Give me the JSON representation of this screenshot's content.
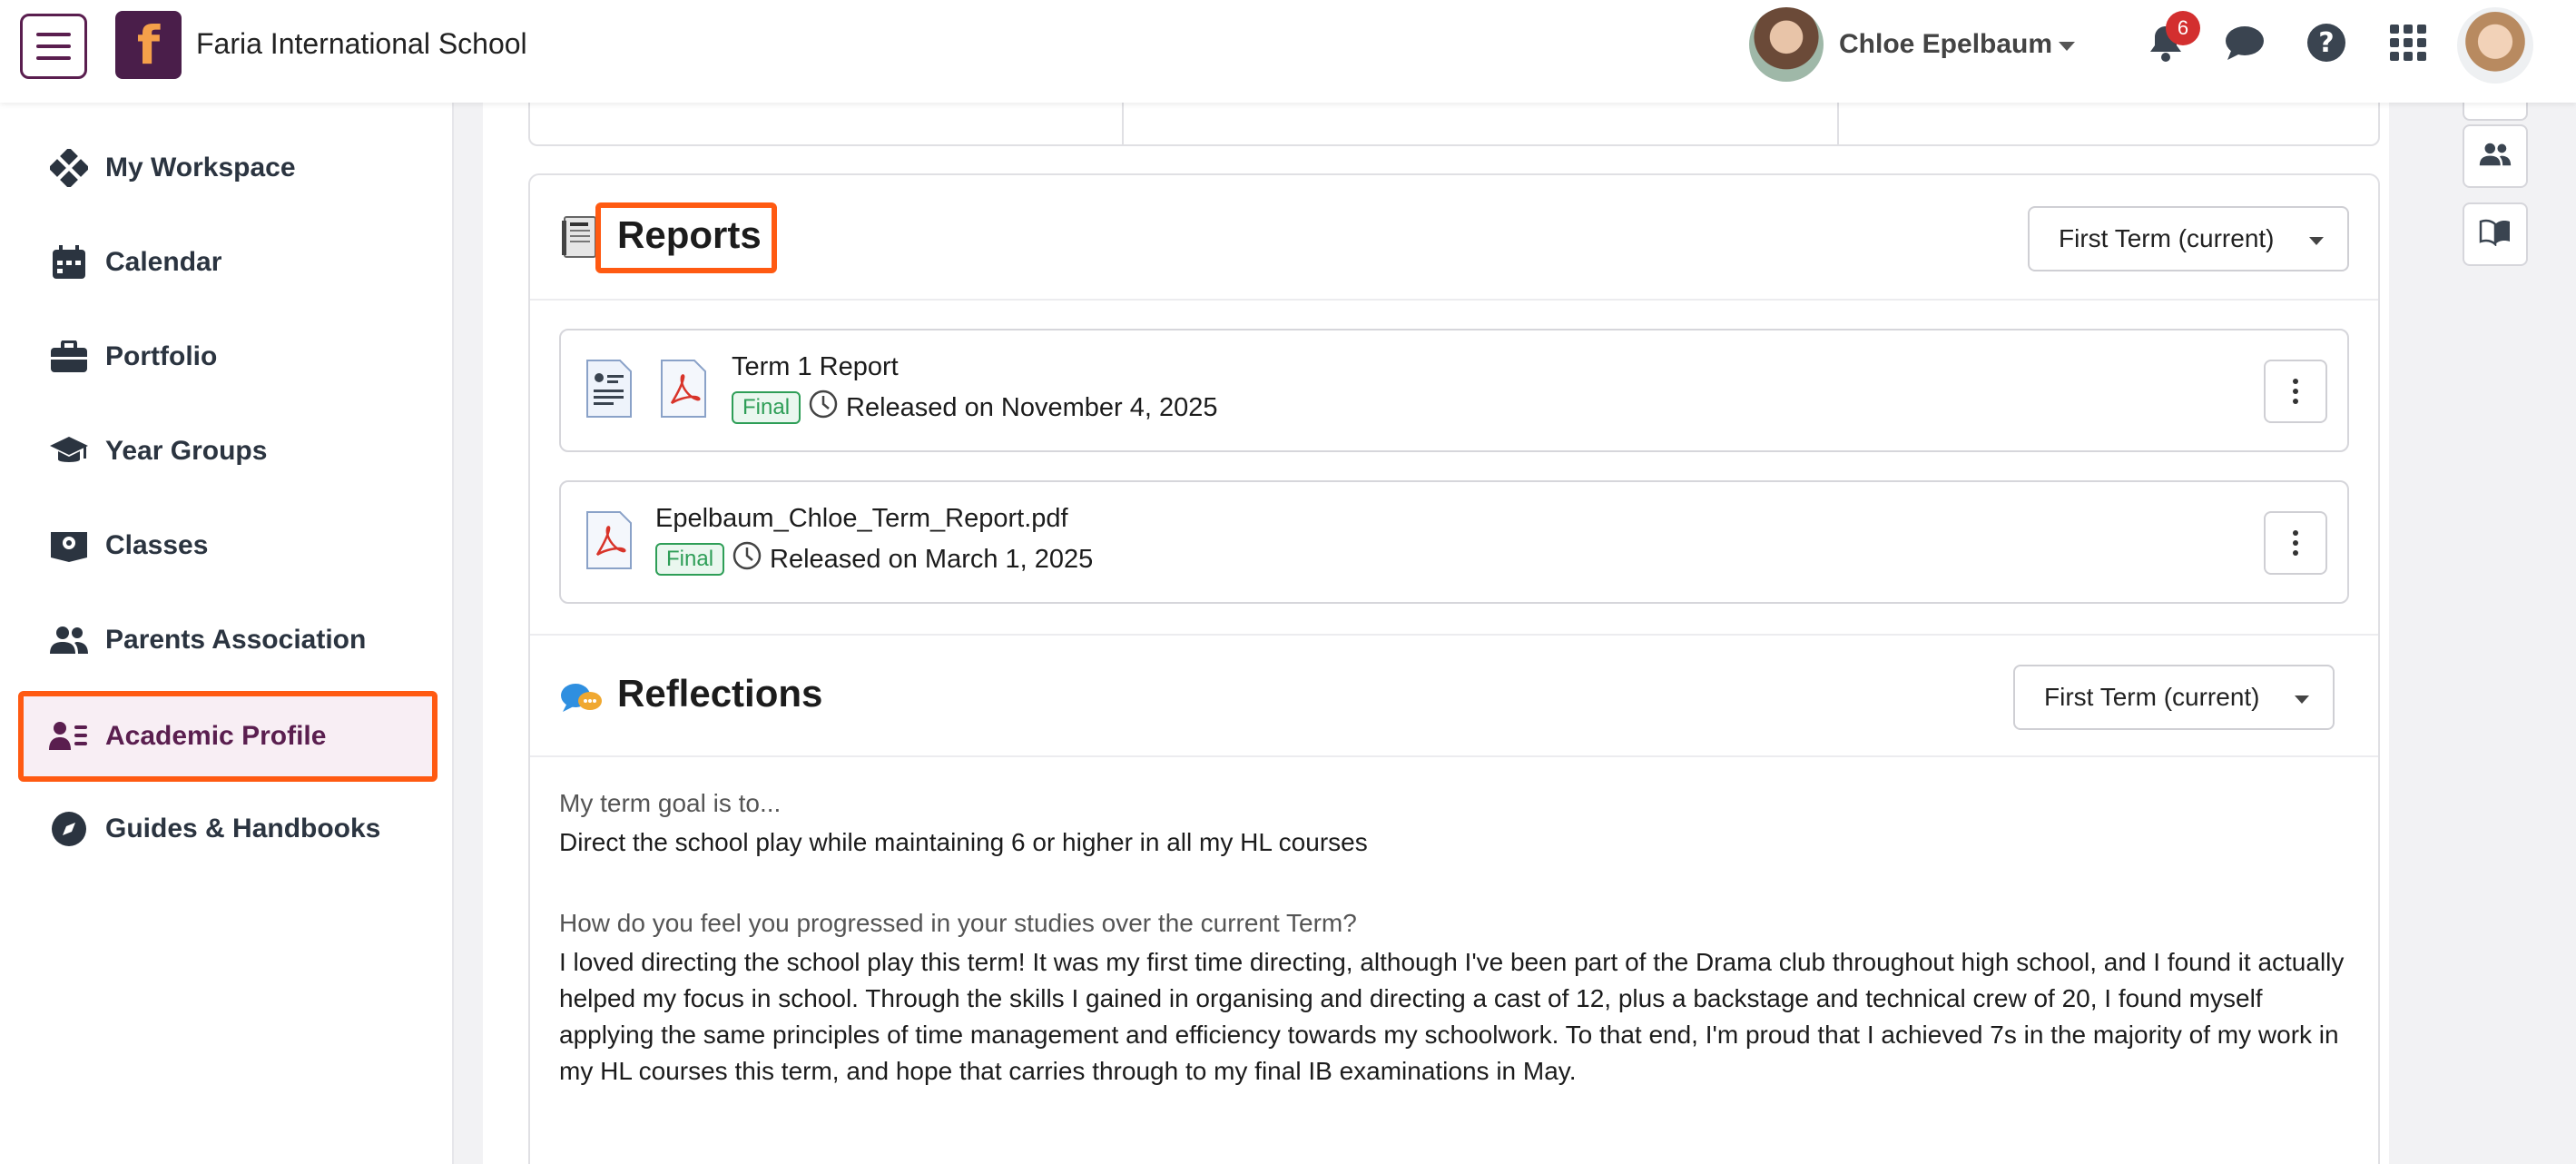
{
  "header": {
    "school_name": "Faria International School",
    "logo_letter": "f",
    "user_name": "Chloe Epelbaum",
    "notification_count": "6"
  },
  "sidebar": {
    "items": [
      {
        "label": "My Workspace",
        "icon": "workspace-icon"
      },
      {
        "label": "Calendar",
        "icon": "calendar-icon"
      },
      {
        "label": "Portfolio",
        "icon": "briefcase-icon"
      },
      {
        "label": "Year Groups",
        "icon": "graduation-cap-icon"
      },
      {
        "label": "Classes",
        "icon": "classes-icon"
      },
      {
        "label": "Parents Association",
        "icon": "people-icon"
      },
      {
        "label": "Academic Profile",
        "icon": "profile-list-icon",
        "active": true
      },
      {
        "label": "Guides & Handbooks",
        "icon": "compass-icon"
      }
    ]
  },
  "reports": {
    "title": "Reports",
    "term_select": "First Term (current)",
    "rows": [
      {
        "name": "Term 1 Report",
        "status": "Final",
        "released": "Released on November 4, 2025"
      },
      {
        "name": "Epelbaum_Chloe_Term_Report.pdf",
        "status": "Final",
        "released": "Released on March 1, 2025"
      }
    ]
  },
  "reflections": {
    "title": "Reflections",
    "term_select": "First Term (current)",
    "questions": [
      {
        "label": "My term goal is to...",
        "answer": "Direct the school play while maintaining 6 or higher in all my HL courses"
      },
      {
        "label": "How do you feel you progressed in your studies over the current Term?",
        "answer": "I loved directing the school play this term! It was my first time directing, although I've been part of the Drama club throughout high school, and I found it actually helped my focus in school. Through the skills I gained in organising and directing a cast of 12, plus a backstage and technical crew of 20, I found myself applying the same principles of time management and efficiency towards my schoolwork. To that end, I'm proud that I achieved 7s in the majority of my work in my HL courses this term, and hope that carries through to my final IB examinations in May."
      }
    ]
  },
  "colors": {
    "brand": "#5a1e4f",
    "highlight": "#ff5a12",
    "final_tag": "#2e9e57",
    "badge": "#d32f2f"
  }
}
